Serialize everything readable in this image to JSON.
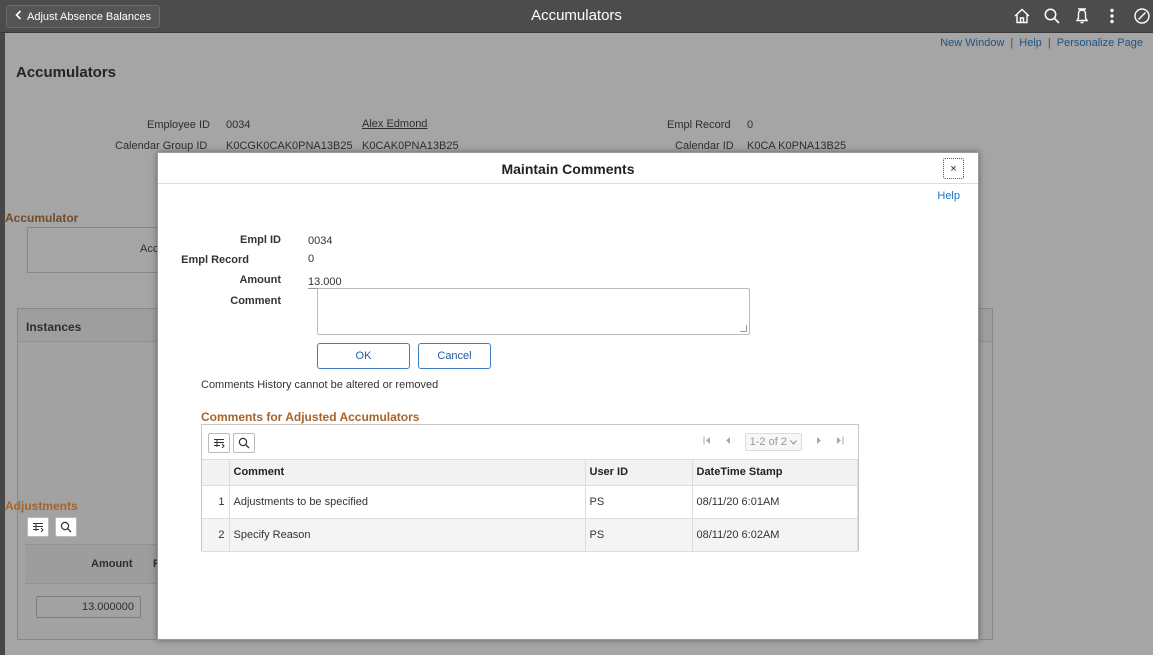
{
  "header": {
    "back_label": "Adjust Absence Balances",
    "title": "Accumulators",
    "icons": [
      "home-icon",
      "search-icon",
      "notifications-icon",
      "actions-menu-icon",
      "navbar-icon"
    ]
  },
  "page": {
    "links": {
      "new_window": "New Window",
      "sep1": "|",
      "help": "Help",
      "sep2": "|",
      "personalize": "Personalize Page"
    },
    "title": "Accumulators",
    "employee_id_label": "Employee ID",
    "employee_id": "0034",
    "employee_name": "Alex Edmond",
    "empl_record_label": "Empl Record",
    "empl_record": "0",
    "calendar_group_label": "Calendar Group ID",
    "calendar_group_id": "K0CGK0CAK0PNA13B25",
    "calendar_group_desc": "K0CAK0PNA13B25",
    "calendar_id_label": "Calendar ID",
    "calendar_id": "K0CA K0PNA13B25",
    "accumulator_section": "Accumulator",
    "accumulator_partial": "Acc",
    "instances_section": "Instances",
    "adjustments_section": "Adjustments",
    "adj_amount_header": "Amount",
    "adj_partial_header": "Re",
    "adj_amount_value": "13.000000"
  },
  "modal": {
    "title": "Maintain Comments",
    "close": "×",
    "help": "Help",
    "empl_id_label": "Empl ID",
    "empl_id": "0034",
    "empl_record_label": "Empl Record",
    "empl_record": "0",
    "amount_label": "Amount",
    "amount": "13.000",
    "comment_label": "Comment",
    "comment_value": "",
    "ok": "OK",
    "cancel": "Cancel",
    "note": "Comments History cannot be altered or removed",
    "grid_title": "Comments for Adjusted Accumulators",
    "pager": "1-2 of 2",
    "columns": [
      "Comment",
      "User ID",
      "DateTime Stamp"
    ],
    "rows": [
      {
        "num": "1",
        "comment": "Adjustments to be specified",
        "user_id": "PS",
        "stamp": "08/11/20  6:01AM"
      },
      {
        "num": "2",
        "comment": "Specify Reason",
        "user_id": "PS",
        "stamp": "08/11/20  6:02AM"
      }
    ]
  }
}
